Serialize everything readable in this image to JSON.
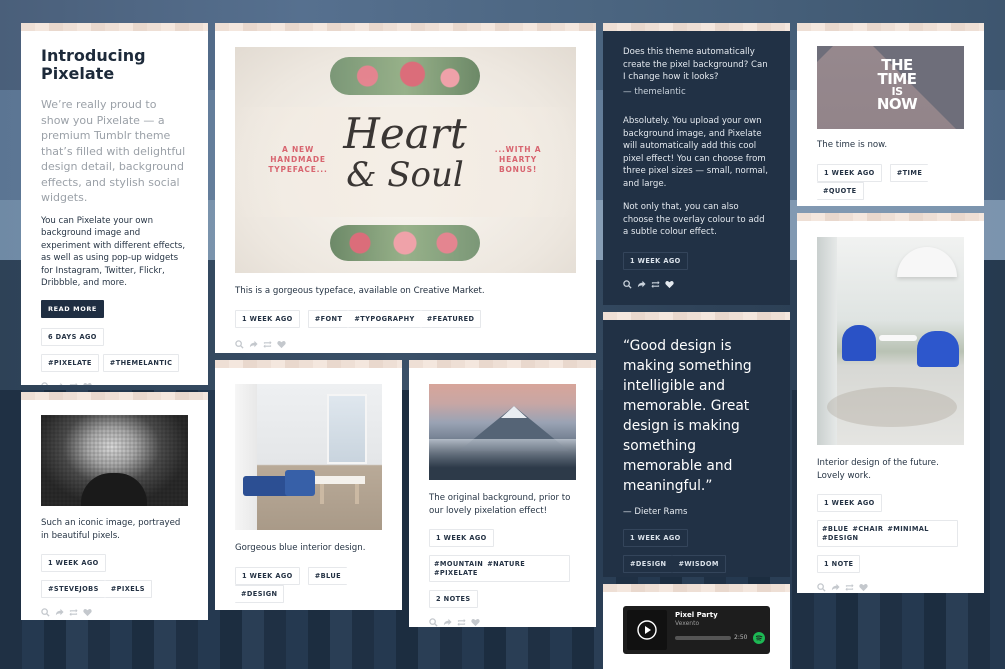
{
  "intro": {
    "title": "Introducing Pixelate",
    "lead": "We’re really proud to show you Pixelate — a premium Tumblr theme that’s filled with delightful design detail, background effects, and stylish social widgets.",
    "body": "You can Pixelate your own background image and experiment with different effects, as well as using pop-up widgets for Instagram, Twitter, Flickr, Dribbble, and more.",
    "button": "READ MORE",
    "time": "6 DAYS AGO",
    "tags": [
      "#PIXELATE",
      "#THEMELANTIC"
    ]
  },
  "heart": {
    "image_left_text": "A NEW HANDMADE TYPEFACE...",
    "image_title_1": "Heart",
    "image_title_2": "& Soul",
    "image_right_text": "...WITH A HEARTY BONUS!",
    "caption_prefix": "This is a gorgeous typeface, available on ",
    "caption_link": "Creative Market",
    "caption_suffix": ".",
    "time": "1 WEEK AGO",
    "tags": [
      "#FONT",
      "#TYPOGRAPHY",
      "#FEATURED"
    ]
  },
  "qa": {
    "question": "Does this theme automatically create the pixel background? Can I change how it looks?",
    "asker": "— themelantic",
    "answer_1": "Absolutely. You upload your own background image, and Pixelate will automatically add this cool pixel effect! You can choose from three pixel sizes — small, normal, and large.",
    "answer_2": "Not only that, you can also choose the overlay colour to add a subtle colour effect.",
    "time": "1 WEEK AGO"
  },
  "time_card": {
    "image_text": [
      "THE",
      "TIME",
      "IS",
      "NOW"
    ],
    "caption": "The time is now.",
    "time": "1 WEEK AGO",
    "tags": [
      "#TIME",
      "#QUOTE"
    ]
  },
  "jobs": {
    "caption": "Such an iconic image, portrayed in beautiful pixels.",
    "time": "1 WEEK AGO",
    "tags": [
      "#STEVEJOBS",
      "#PIXELS"
    ]
  },
  "interior_blue": {
    "caption": "Gorgeous blue interior design.",
    "time": "1 WEEK AGO",
    "tags": [
      "#BLUE",
      "#DESIGN"
    ]
  },
  "mountain": {
    "caption": "The original background, prior to our lovely pixelation effect!",
    "time": "1 WEEK AGO",
    "tags": [
      "#MOUNTAIN",
      "#NATURE",
      "#PIXELATE"
    ],
    "notes": "2 NOTES"
  },
  "quote_card": {
    "quote": "“Good design is making something intelligible and memorable. Great design is making something memorable and meaningful.”",
    "author": "— Dieter Rams",
    "time": "1 WEEK AGO",
    "tags": [
      "#DESIGN",
      "#WISDOM"
    ]
  },
  "future": {
    "caption": "Interior design of the future. Lovely work.",
    "time": "1 WEEK AGO",
    "tags": [
      "#BLUE",
      "#CHAIR",
      "#MINIMAL",
      "#DESIGN"
    ],
    "notes": "1 NOTE"
  },
  "player": {
    "track": "Pixel Party",
    "artist": "Vexento",
    "duration": "2:50"
  },
  "colors": {
    "background": "#33465e",
    "dark_card": "#213145",
    "button": "#1f2e42",
    "spotify": "#1db954"
  }
}
